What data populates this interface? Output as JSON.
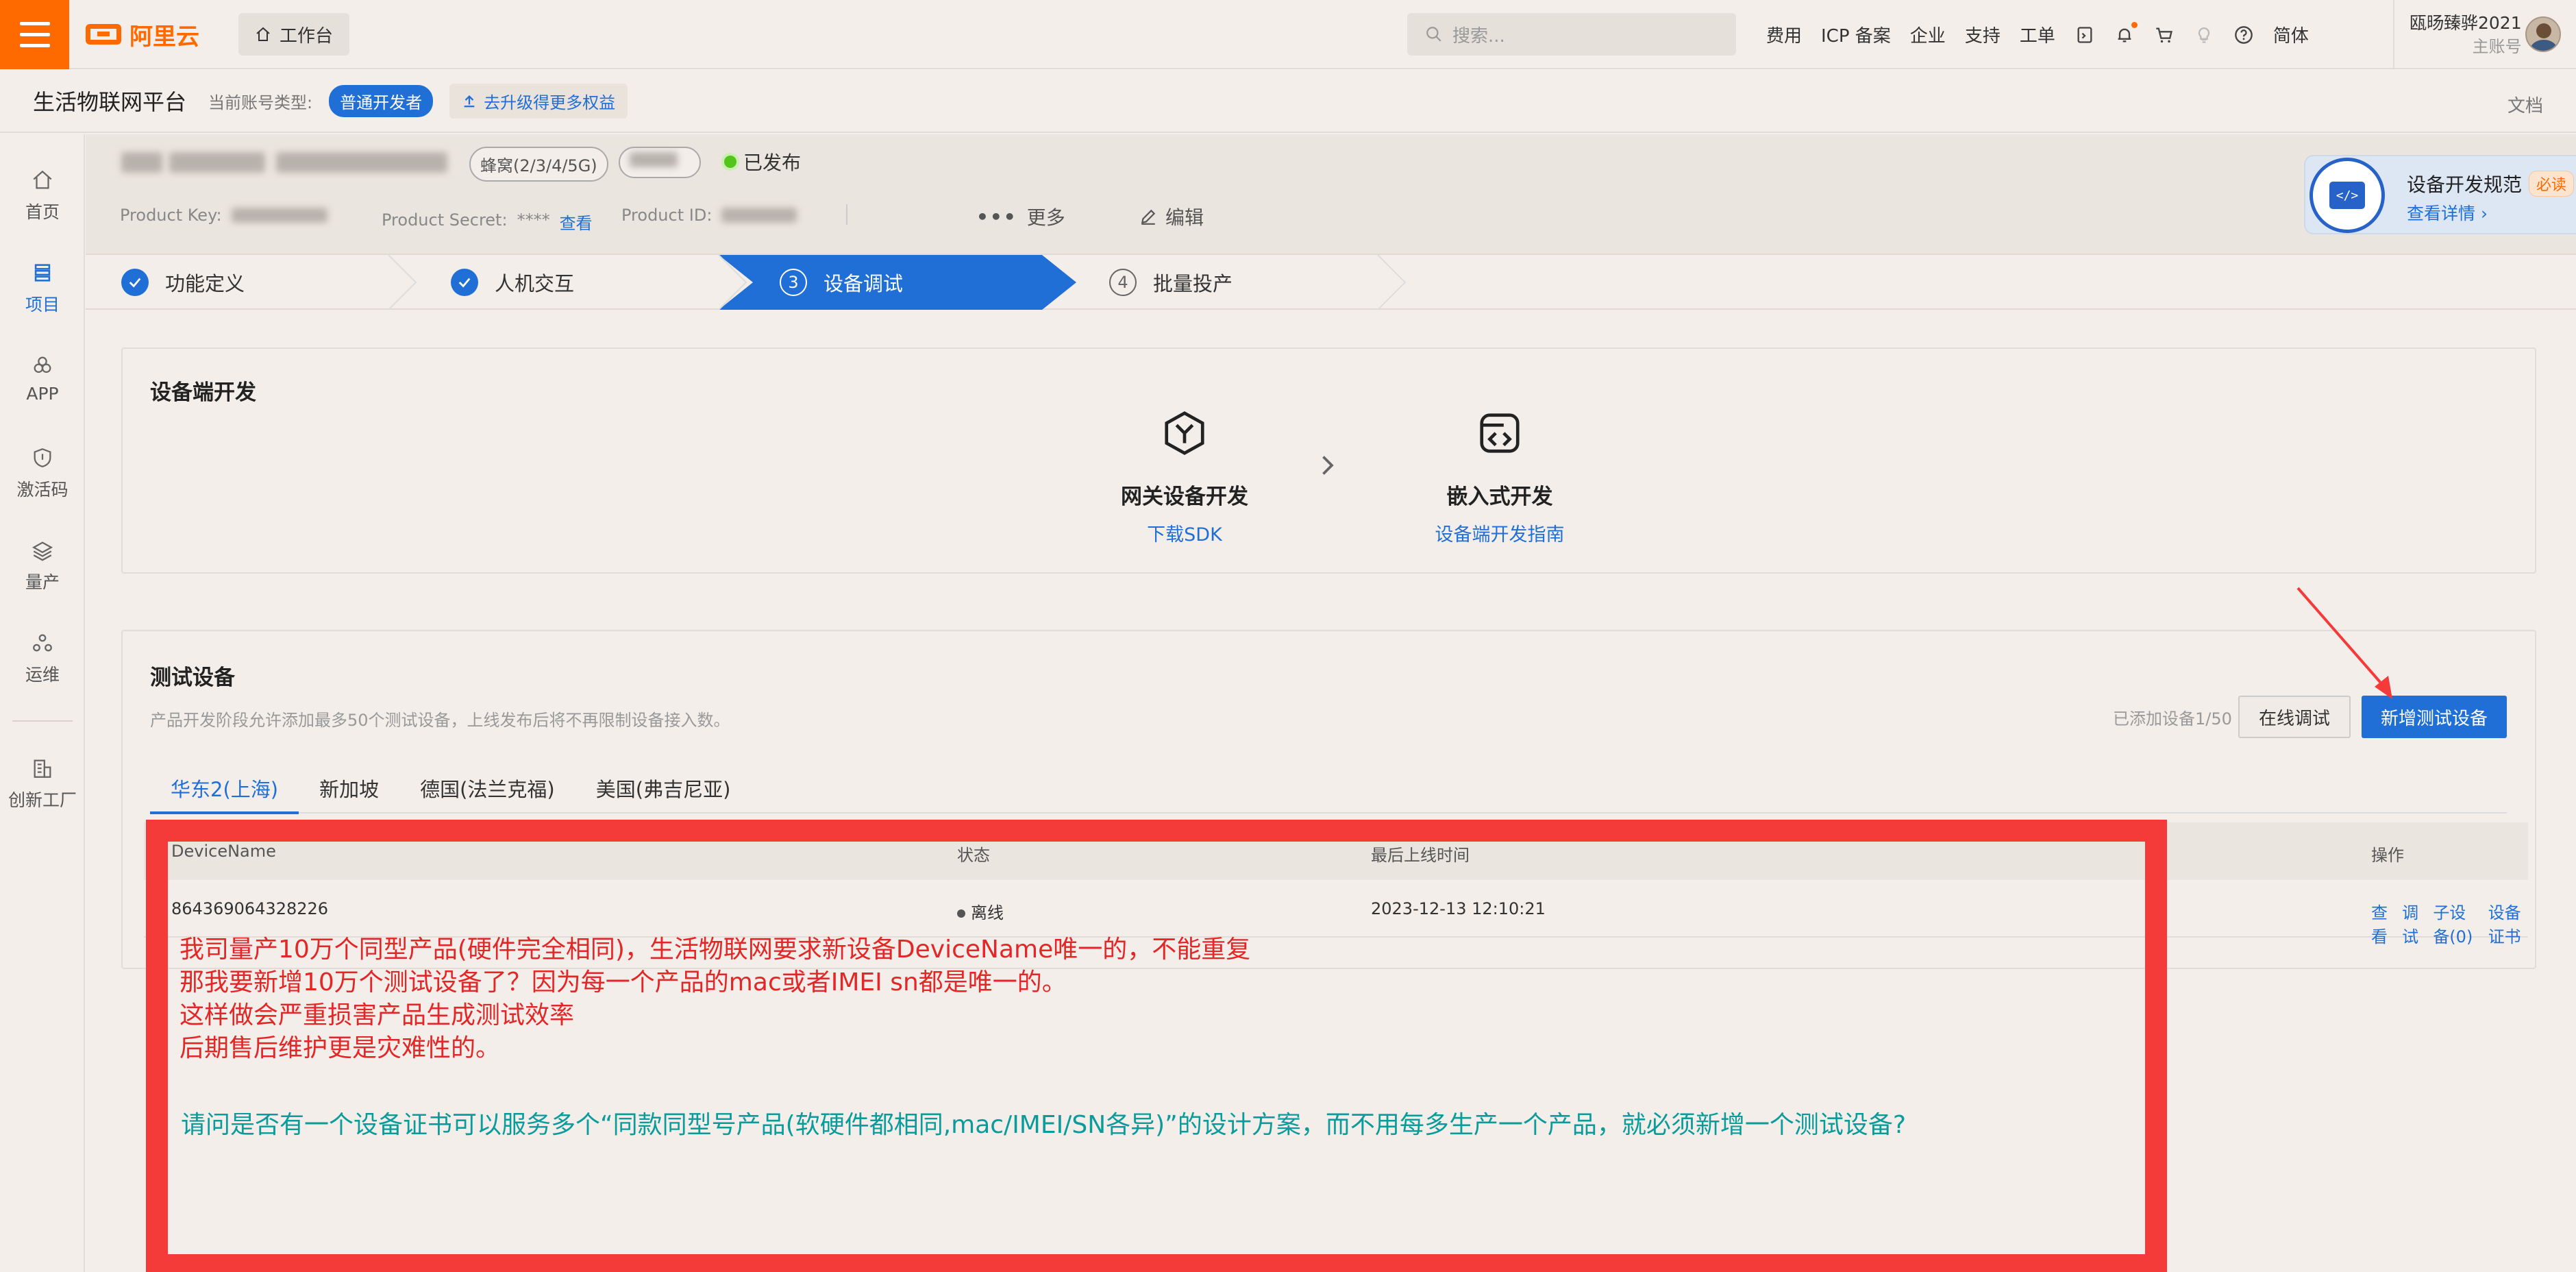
{
  "topbar": {
    "brand": "阿里云",
    "workbench": "工作台",
    "search_placeholder": "搜索...",
    "nav": [
      "费用",
      "ICP 备案",
      "企业",
      "支持",
      "工单"
    ],
    "lang": "简体",
    "user_name": "瓯旸臻骅2021",
    "user_role": "主账号"
  },
  "subbar": {
    "title": "生活物联网平台",
    "acct_label": "当前账号类型:",
    "acct_type": "普通开发者",
    "upgrade": "去升级得更多权益",
    "docs": "文档"
  },
  "sidebar": {
    "items": [
      {
        "label": "首页",
        "icon": "home-icon"
      },
      {
        "label": "项目",
        "icon": "project-icon",
        "active": true
      },
      {
        "label": "APP",
        "icon": "app-icon"
      },
      {
        "label": "激活码",
        "icon": "shield-icon"
      },
      {
        "label": "量产",
        "icon": "layers-icon"
      },
      {
        "label": "运维",
        "icon": "ops-icon"
      },
      {
        "label": "创新工厂",
        "icon": "factory-icon"
      }
    ]
  },
  "product": {
    "network_tag": "蜂窝(2/3/4/5G)",
    "status": "已发布",
    "product_key_label": "Product Key:",
    "product_secret_label": "Product Secret:",
    "product_secret_value": "****",
    "view": "查看",
    "product_id_label": "Product ID:",
    "more": "更多",
    "edit": "编辑",
    "spec_title": "设备开发规范",
    "spec_badge": "必读",
    "spec_link": "查看详情"
  },
  "steps": [
    {
      "label": "功能定义",
      "state": "done"
    },
    {
      "label": "人机交互",
      "state": "done"
    },
    {
      "label": "设备调试",
      "num": "3",
      "state": "active"
    },
    {
      "label": "批量投产",
      "num": "4",
      "state": "todo"
    }
  ],
  "device_dev": {
    "title": "设备端开发",
    "gateway_title": "网关设备开发",
    "gateway_link": "下载SDK",
    "embedded_title": "嵌入式开发",
    "embedded_link": "设备端开发指南"
  },
  "test_devices": {
    "title": "测试设备",
    "desc": "产品开发阶段允许添加最多50个测试设备，上线发布后将不再限制设备接入数。",
    "count": "已添加设备1/50",
    "online_debug": "在线调试",
    "add_device": "新增测试设备",
    "regions": [
      "华东2(上海)",
      "新加坡",
      "德国(法兰克福)",
      "美国(弗吉尼亚)"
    ],
    "columns": {
      "name": "DeviceName",
      "status": "状态",
      "last_online": "最后上线时间",
      "ops": "操作"
    },
    "rows": [
      {
        "name": "864369064328226",
        "status": "离线",
        "last_online": "2023-12-13 12:10:21",
        "ops": [
          "查看",
          "调试",
          "子设备(0)",
          "设备证书"
        ]
      }
    ]
  },
  "annotation": {
    "lines": [
      "我司量产10万个同型产品(硬件完全相同)，生活物联网要求新设备DeviceName唯一的，不能重复",
      "那我要新增10万个测试设备了？因为每一个产品的mac或者IMEI sn都是唯一的。",
      "这样做会严重损害产品生成测试效率",
      "后期售后维护更是灾难性的。"
    ],
    "question": "请问是否有一个设备证书可以服务多个“同款同型号产品(软硬件都相同,mac/IMEI/SN各异)”的设计方案，而不用每多生产一个产品，就必须新增一个测试设备?",
    "frame_color": "#f53a3a",
    "text_color": "#e32626",
    "question_color": "#0a9b9b"
  },
  "colors": {
    "brand": "#ff6a00",
    "primary": "#1f6fd6"
  }
}
